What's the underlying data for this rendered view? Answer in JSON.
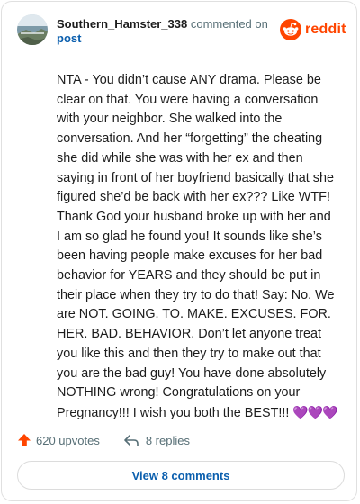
{
  "comment": {
    "author": "Southern_Hamster_338",
    "action_text": "commented on",
    "target_text": "post",
    "brand": {
      "name": "reddit",
      "color": "#ff4500"
    },
    "body": "NTA - You didn’t cause ANY drama. Please be clear on that. You were having a conversation with your neighbor. She walked into the conversation. And her “forgetting” the cheating she did while she was with her ex and then saying in front of her boyfriend basically that she figured she’d be back with her ex??? Like WTF! Thank God your husband broke up with her and I am so glad he found you! It sounds like she’s been having people make excuses for her bad behavior for YEARS and they should be put in their place when they try to do that! Say: No. We are NOT. GOING. TO. MAKE. EXCUSES. FOR. HER. BAD. BEHAVIOR. Don’t let anyone treat you like this and then they try to make out that you are the bad guy! You have done absolutely NOTHING wrong! Congratulations on your Pregnancy!!! I wish you both the BEST!!!",
    "hearts": "💜💜💜",
    "upvotes_label": "620 upvotes",
    "replies_label": "8 replies",
    "view_comments_label": "View 8 comments"
  },
  "colors": {
    "upvote": "#ff4500",
    "link": "#0b5fae",
    "muted": "#576f76",
    "heart": "#9b3df2"
  },
  "icons": {
    "avatar": "avatar",
    "brand_logo": "reddit-snoo-icon",
    "upvote": "upvote-arrow-icon",
    "reply": "reply-arrow-icon"
  }
}
